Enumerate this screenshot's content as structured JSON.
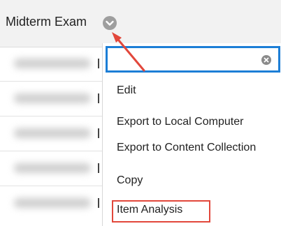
{
  "column": {
    "title": "Midterm Exam",
    "chevron_icon": "chevron-down-icon"
  },
  "menu": {
    "search": {
      "value": "",
      "placeholder": ""
    },
    "clear_icon": "clear-icon",
    "items": [
      {
        "label": "Edit"
      },
      {
        "label": "Export to Local Computer"
      },
      {
        "label": "Export to Content Collection"
      },
      {
        "label": "Copy"
      },
      {
        "label": "Item Analysis"
      }
    ]
  },
  "colors": {
    "search_border": "#1c7ed6",
    "highlight": "#e2473b",
    "arrow": "#e2473b"
  }
}
